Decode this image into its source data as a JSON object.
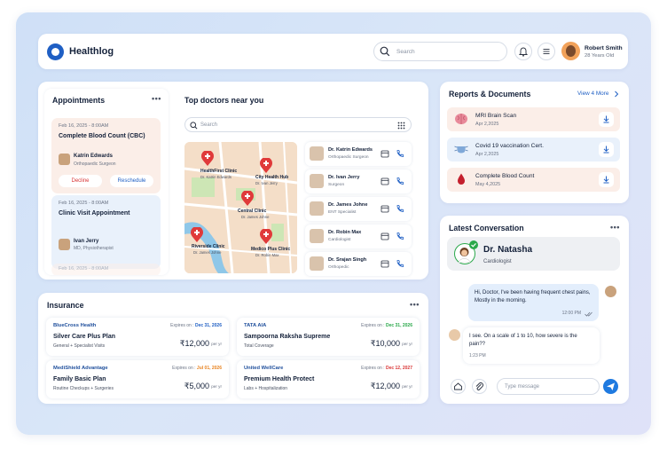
{
  "app": {
    "name": "Healthlog"
  },
  "header": {
    "search_placeholder": "Search",
    "user_name": "Robert Smith",
    "user_age": "28 Years Old"
  },
  "appointments": {
    "title": "Appointments",
    "items": [
      {
        "date": "Feb 16, 2025 - 8:00AM",
        "title": "Complete Blood Count (CBC)",
        "doctor": "Katrin Edwards",
        "specialty": "Orthopaedic Surgeon",
        "decline": "Decline",
        "reschedule": "Reschedule"
      },
      {
        "date": "Feb 16, 2025 - 8:00AM",
        "title": "Clinic Visit Appointment",
        "doctor": "Ivan Jerry",
        "specialty": "MD, Physiotherapist"
      },
      {
        "date": "Feb 16, 2025 - 8:00AM"
      }
    ]
  },
  "doctors": {
    "title": "Top doctors near you",
    "search_placeholder": "Search",
    "map_pins": [
      {
        "name": "HealthFirst Clinic",
        "doctor": "Dr. Katrin Edwards"
      },
      {
        "name": "City Health Hub",
        "doctor": "Dr. Ivan Jerry"
      },
      {
        "name": "Central Clinic",
        "doctor": "Dr. James Johne"
      },
      {
        "name": "Riverside Clinic",
        "doctor": "Dr. James Johne"
      },
      {
        "name": "Medico Plus Clinic",
        "doctor": "Dr. Robin Max"
      }
    ],
    "list": [
      {
        "name": "Dr. Katrin Edwards",
        "specialty": "Orthopaedic Surgeon"
      },
      {
        "name": "Dr. Ivan Jerry",
        "specialty": "Surgeon"
      },
      {
        "name": "Dr. James Johne",
        "specialty": "ENT Specialist"
      },
      {
        "name": "Dr. Robin Max",
        "specialty": "Cardiologist"
      },
      {
        "name": "Dr. Srajan Singh",
        "specialty": "Orthopedic"
      }
    ]
  },
  "insurance": {
    "title": "Insurance",
    "items": [
      {
        "brand": "BlueCross Health",
        "expires_label": "Expires on :",
        "expires": "Dec 31, 2026",
        "expires_color": "#1f5fc4",
        "plan": "Silver Care Plus Plan",
        "coverage": "General + Specialist Visits",
        "price": "₹12,000",
        "per": "per yr"
      },
      {
        "brand": "TATA AIA",
        "expires_label": "Expires on :",
        "expires": "Dec 31, 2026",
        "expires_color": "#2aa84a",
        "plan": "Sampoorna Raksha Supreme",
        "coverage": "Total Coverage",
        "price": "₹10,000",
        "per": "per yr"
      },
      {
        "brand": "MediShield Advantage",
        "expires_label": "Expires on :",
        "expires": "Jul 01, 2026",
        "expires_color": "#e8821e",
        "plan": "Family Basic Plan",
        "coverage": "Routine Checkups + Surgeries",
        "price": "₹5,000",
        "per": "per yr"
      },
      {
        "brand": "United WellCare",
        "expires_label": "Expires on :",
        "expires": "Dec 12, 2027",
        "expires_color": "#d93636",
        "plan": "Premium Health Protect",
        "coverage": "Labs + Hospitalization",
        "price": "₹12,000",
        "per": "per yr"
      }
    ]
  },
  "reports": {
    "title": "Reports & Documents",
    "view_more": "View 4 More",
    "items": [
      {
        "name": "MRI Brain Scan",
        "date": "Apr 2,2025",
        "bg": "#fbeee8"
      },
      {
        "name": "Covid 19 vaccination Cert.",
        "date": "Apr 2,2025",
        "bg": "#e9f1fb"
      },
      {
        "name": "Complete Blood Count",
        "date": "May 4,2025",
        "bg": "#fbeee8"
      }
    ]
  },
  "conversation": {
    "title": "Latest Conversation",
    "doctor_name": "Dr. Natasha",
    "doctor_specialty": "Cardiologist",
    "messages": [
      {
        "text": "Hi, Doctor, I've been having frequent chest pains, Mostly in the morning.",
        "time": "12:00 PM"
      },
      {
        "text": "I see. On a scale of 1 to 10, how severe is the pain??",
        "time": "1:23 PM"
      }
    ],
    "input_placeholder": "Type message"
  }
}
